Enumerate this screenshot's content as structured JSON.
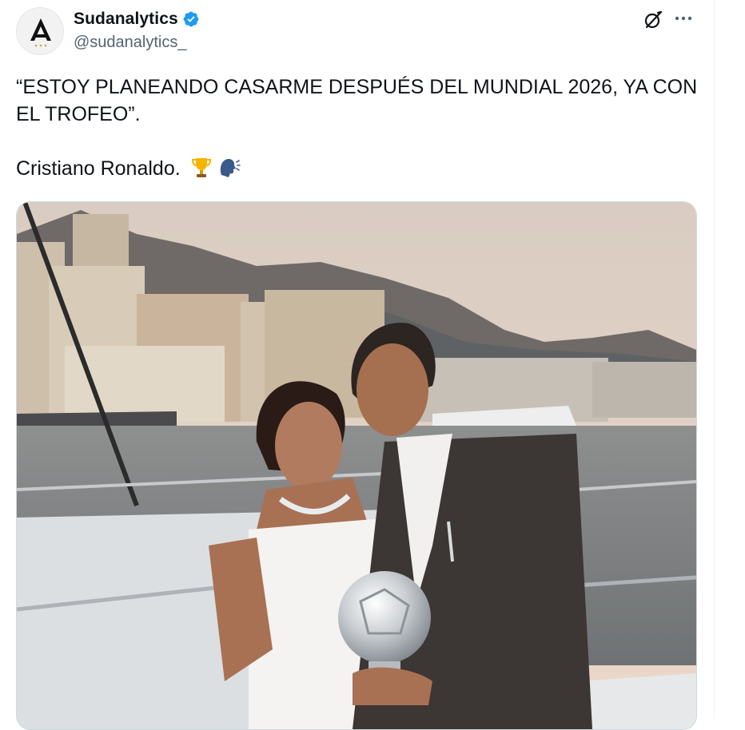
{
  "author": {
    "display_name": "Sudanalytics",
    "handle": "@sudanalytics_",
    "verified": true,
    "avatar_icon": "sudanalytics-logo-icon"
  },
  "actions": {
    "grok_icon": "grok-icon",
    "more_icon": "more-icon"
  },
  "tweet": {
    "text": "“ESTOY PLANEANDO CASARME DESPUÉS DEL MUNDIAL 2026, YA CON EL TROFEO”.\n\nCristiano Ronaldo. ",
    "emojis": [
      "trophy-emoji",
      "speaking-head-emoji"
    ]
  },
  "media": {
    "type": "photo",
    "icon": "photo-couple-harbor"
  },
  "colors": {
    "verified_badge": "#1d9bf0",
    "secondary_text": "#536471",
    "border": "#cfd9de"
  }
}
